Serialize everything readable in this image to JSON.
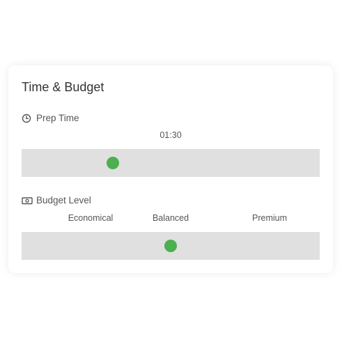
{
  "card": {
    "title": "Time & Budget"
  },
  "prep_time": {
    "label": "Prep Time",
    "icon": "clock-icon",
    "value_text": "01:30",
    "slider_fraction": 0.305
  },
  "budget": {
    "label": "Budget Level",
    "icon": "banknote-icon",
    "levels": [
      "Economical",
      "Balanced",
      "Premium"
    ],
    "selected_index": 1
  },
  "colors": {
    "thumb": "#4caf50",
    "track": "#e0e0e0",
    "text": "#555555",
    "title": "#333333"
  }
}
